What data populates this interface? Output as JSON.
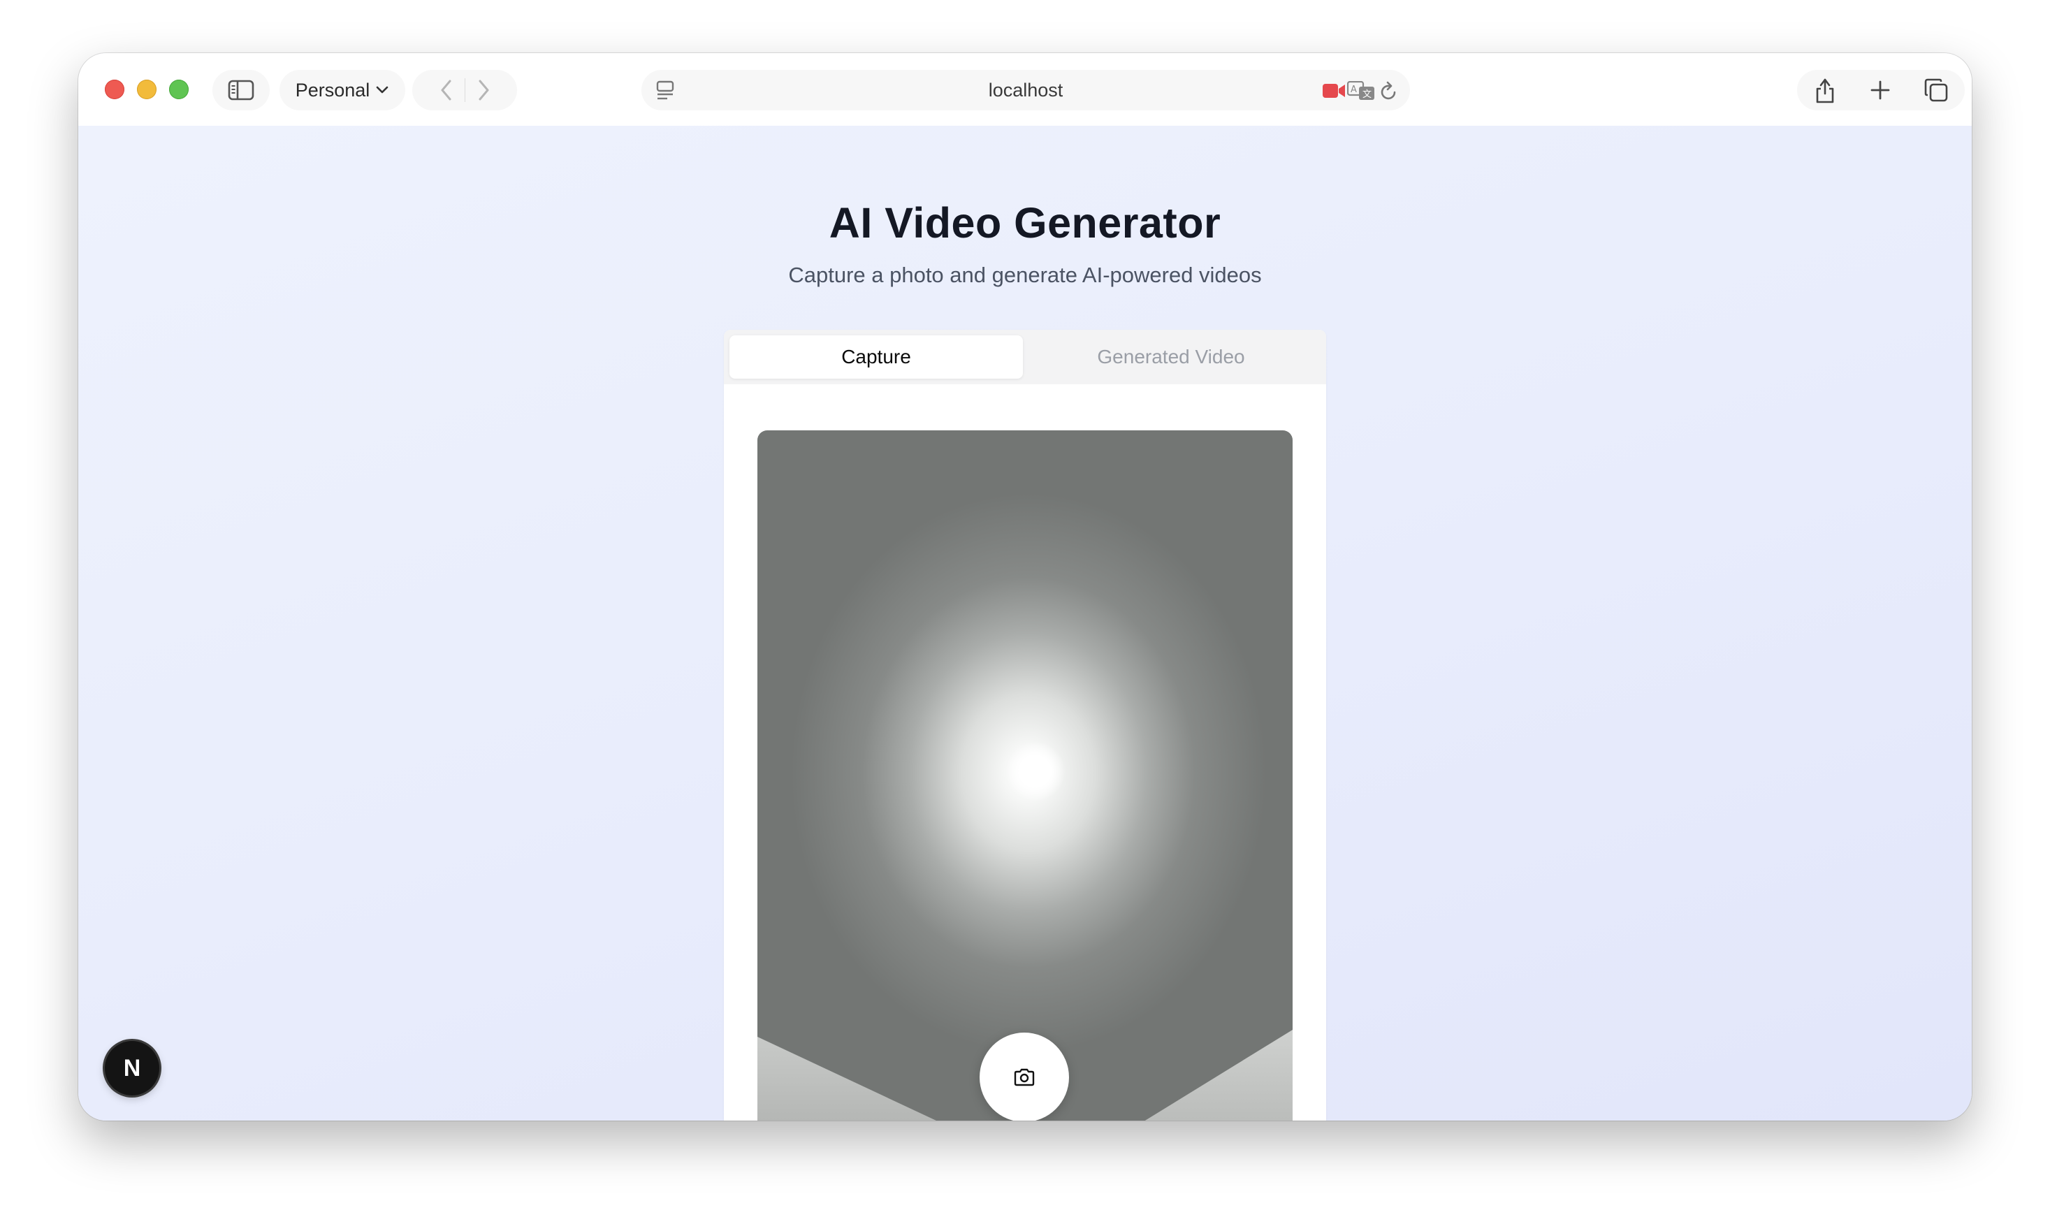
{
  "browser": {
    "profile_label": "Personal",
    "url": "localhost"
  },
  "page": {
    "title": "AI Video Generator",
    "subtitle": "Capture a photo and generate AI-powered videos"
  },
  "tabs": [
    {
      "label": "Capture",
      "active": true
    },
    {
      "label": "Generated Video",
      "active": false
    }
  ],
  "dev_badge": {
    "letter": "N"
  },
  "icons": {
    "sidebar": "sidebar-icon",
    "back": "chevron-left-icon",
    "forward": "chevron-right-icon",
    "reader": "reader-icon",
    "recording": "camera-recording-icon",
    "translate": "translate-icon",
    "reload": "reload-icon",
    "share": "share-icon",
    "new_tab": "plus-icon",
    "tabs_overview": "tabs-icon",
    "shutter": "camera-icon"
  },
  "colors": {
    "recording": "#e5484d",
    "accent_text": "#141824"
  }
}
